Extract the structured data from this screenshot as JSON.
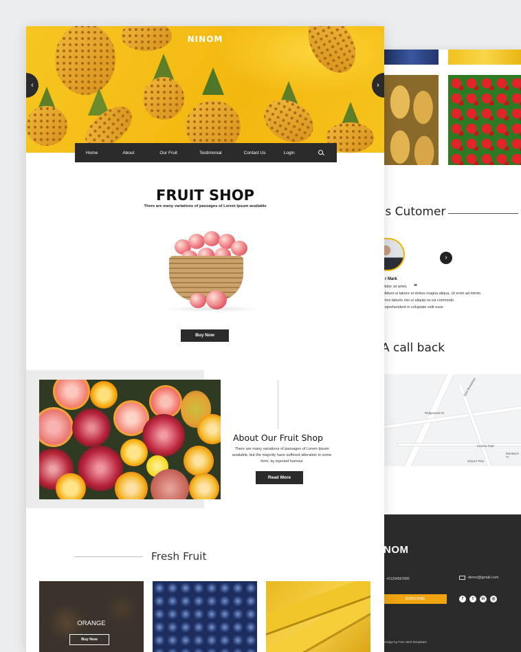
{
  "brand": "NINOM",
  "nav": [
    "Home",
    "About",
    "Our Fruit",
    "Testimonial",
    "Contact Us",
    "Login"
  ],
  "hero": {
    "prev": "‹",
    "next": "›"
  },
  "shop": {
    "title": "FRUIT SHOP",
    "subtitle": "There are many variations of passages of Lorem Ipsum available",
    "button": "Buy Now"
  },
  "about": {
    "title": "About Our Fruit Shop",
    "text": "There are many variations of passages of Lorem Ipsum available, but the majority have suffered alteration in some form, by injected humour",
    "button": "Read More"
  },
  "fresh": {
    "title": "Fresh  Fruit",
    "card_label": "ORANGE",
    "card_button": "Buy Now"
  },
  "back_page": {
    "testimonial_title": "as Cutomer",
    "testimonial_name": "r Mark",
    "testimonial_lines": [
      "dolor sit amet,",
      "didunt ut labore et dolore magna aliqua. Ut enim ad minim",
      "mco laboris nisi ut aliquip ex ea commodo",
      "reprehenderit in voluptate velit esse"
    ],
    "next": "›",
    "callback_title": "A call back",
    "map_labels": [
      "East Broadway",
      "Ridgewood St",
      "Kearse Park",
      "Glacier Plus",
      "Monkey's Tr"
    ],
    "footer_logo": "NOM",
    "phone": "+01234567890",
    "email": "demo@gmail.com",
    "subscribe": "SUBSCRIBE",
    "social": [
      "f",
      "t",
      "in",
      "◎"
    ],
    "copyright": "Design by Free Html Templates"
  }
}
